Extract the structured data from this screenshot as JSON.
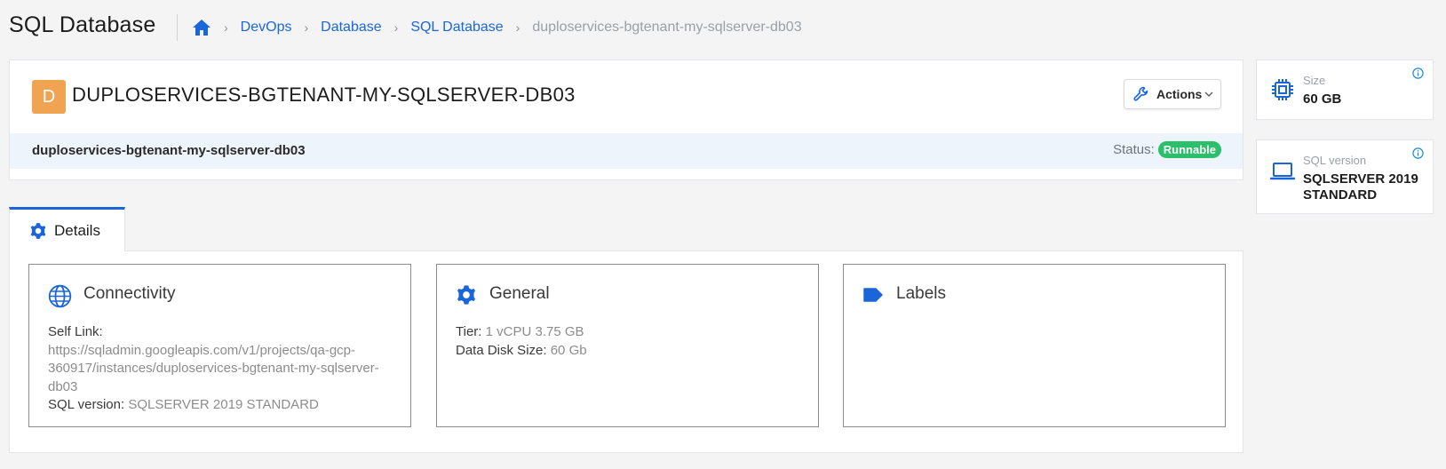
{
  "header": {
    "title": "SQL Database",
    "breadcrumb": [
      "DevOps",
      "Database",
      "SQL Database"
    ],
    "breadcrumb_current": "duploservices-bgtenant-my-sqlserver-db03"
  },
  "resource": {
    "avatar_letter": "D",
    "title": "DUPLOSERVICES-BGTENANT-MY-SQLSERVER-DB03",
    "actions_label": "Actions",
    "subname": "duploservices-bgtenant-my-sqlserver-db03",
    "status_label": "Status:",
    "status_value": "Runnable"
  },
  "side": {
    "size": {
      "label": "Size",
      "value": "60 GB"
    },
    "version": {
      "label": "SQL version",
      "value": "SQLSERVER 2019 STANDARD"
    }
  },
  "tabs": {
    "details": "Details"
  },
  "connectivity": {
    "title": "Connectivity",
    "self_link_key": "Self Link",
    "self_link_value": "https://sqladmin.googleapis.com/v1/projects/qa-gcp-360917/instances/duploservices-bgtenant-my-sqlserver-db03",
    "sql_version_key": "SQL version",
    "sql_version_value": "SQLSERVER 2019 STANDARD"
  },
  "general": {
    "title": "General",
    "tier_key": "Tier",
    "tier_value": "1 vCPU 3.75 GB",
    "disk_key": "Data Disk Size",
    "disk_value": "60 Gb"
  },
  "labels": {
    "title": "Labels"
  },
  "colors": {
    "accent": "#1a66d9",
    "avatar": "#f0a350",
    "status": "#2bbf6b",
    "sub_bar": "#eef4fb"
  }
}
